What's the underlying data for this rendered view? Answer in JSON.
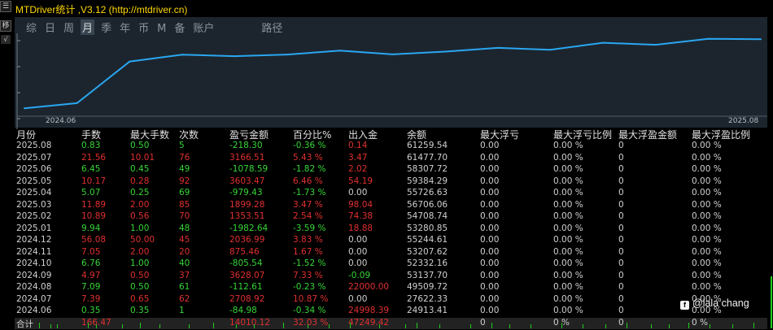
{
  "window": {
    "title": "MTDriver统计 ,V3.12 (http://mtdriver.cn)"
  },
  "left_strip": {
    "top_button": "☰",
    "move_button": "移",
    "check_mark": "√"
  },
  "tabs": [
    {
      "label": "综",
      "active": false
    },
    {
      "label": "日",
      "active": false
    },
    {
      "label": "周",
      "active": false
    },
    {
      "label": "月",
      "active": true
    },
    {
      "label": "季",
      "active": false
    },
    {
      "label": "年",
      "active": false
    },
    {
      "label": "币",
      "active": false
    },
    {
      "label": "M",
      "active": false
    },
    {
      "label": "备",
      "active": false
    },
    {
      "label": "账户",
      "active": false
    },
    {
      "label": "路径",
      "active": false
    }
  ],
  "chart_data": {
    "type": "line",
    "x": [
      "2024.06",
      "2024.07",
      "2024.08",
      "2024.09",
      "2024.10",
      "2024.11",
      "2024.12",
      "2025.01",
      "2025.02",
      "2025.03",
      "2025.04",
      "2025.05",
      "2025.06",
      "2025.07",
      "2025.08"
    ],
    "y": [
      24913.41,
      27622.33,
      49509.72,
      53137.7,
      52332.16,
      53207.62,
      55244.61,
      53280.85,
      54708.74,
      56706.06,
      55726.63,
      59384.29,
      58307.72,
      61477.7,
      61259.54
    ],
    "x_tick_labels": [
      "2024.06",
      "2025.08"
    ],
    "ylim": [
      22000,
      63500
    ],
    "line_color": "#2aa6f0"
  },
  "table": {
    "headers": [
      "月份",
      "手数",
      "最大手数",
      "次数",
      "盈亏金额",
      "百分比%",
      "出入金",
      "余额",
      "最大浮亏",
      "最大浮亏比例",
      "最大浮盈金额",
      "最大浮盈比例"
    ],
    "rows": [
      {
        "cells": [
          "2025.08",
          "0.83",
          "0.50",
          "5",
          "-218.30",
          "-0.36 %",
          "0.14",
          "61259.54",
          "0.00",
          "0.00 %",
          "0",
          "0.00 %"
        ],
        "sign": "neg",
        "flow": "pos"
      },
      {
        "cells": [
          "2025.07",
          "21.56",
          "10.01",
          "76",
          "3166.51",
          "5.43 %",
          "3.47",
          "61477.70",
          "0.00",
          "0.00 %",
          "0",
          "0.00 %"
        ],
        "sign": "pos",
        "flow": "pos"
      },
      {
        "cells": [
          "2025.06",
          "6.45",
          "0.45",
          "49",
          "-1078.59",
          "-1.82 %",
          "2.02",
          "58307.72",
          "0.00",
          "0.00 %",
          "0",
          "0.00 %"
        ],
        "sign": "neg",
        "flow": "pos"
      },
      {
        "cells": [
          "2025.05",
          "10.17",
          "0.28",
          "92",
          "3603.47",
          "6.46 %",
          "54.19",
          "59384.29",
          "0.00",
          "0.00 %",
          "0",
          "0.00 %"
        ],
        "sign": "pos",
        "flow": "pos"
      },
      {
        "cells": [
          "2025.04",
          "5.07",
          "0.25",
          "69",
          "-979.43",
          "-1.73 %",
          "0.00",
          "55726.63",
          "0.00",
          "0.00 %",
          "0",
          "0.00 %"
        ],
        "sign": "neg",
        "flow": "neu"
      },
      {
        "cells": [
          "2025.03",
          "11.89",
          "2.00",
          "85",
          "1899.28",
          "3.47 %",
          "98.04",
          "56706.06",
          "0.00",
          "0.00 %",
          "0",
          "0.00 %"
        ],
        "sign": "pos",
        "flow": "pos"
      },
      {
        "cells": [
          "2025.02",
          "10.89",
          "0.56",
          "70",
          "1353.51",
          "2.54 %",
          "74.38",
          "54708.74",
          "0.00",
          "0.00 %",
          "0",
          "0.00 %"
        ],
        "sign": "pos",
        "flow": "pos"
      },
      {
        "cells": [
          "2025.01",
          "9.94",
          "1.00",
          "48",
          "-1982.64",
          "-3.59 %",
          "18.88",
          "53280.85",
          "0.00",
          "0.00 %",
          "0",
          "0.00 %"
        ],
        "sign": "neg",
        "flow": "pos"
      },
      {
        "cells": [
          "2024.12",
          "56.08",
          "50.00",
          "45",
          "2036.99",
          "3.83 %",
          "0.00",
          "55244.61",
          "0.00",
          "0.00 %",
          "0",
          "0.00 %"
        ],
        "sign": "pos",
        "flow": "neu"
      },
      {
        "cells": [
          "2024.11",
          "7.05",
          "2.00",
          "20",
          "875.46",
          "1.67 %",
          "0.00",
          "53207.62",
          "0.00",
          "0.00 %",
          "0",
          "0.00 %"
        ],
        "sign": "pos",
        "flow": "neu"
      },
      {
        "cells": [
          "2024.10",
          "6.76",
          "1.00",
          "40",
          "-805.54",
          "-1.52 %",
          "0.00",
          "52332.16",
          "0.00",
          "0.00 %",
          "0",
          "0.00 %"
        ],
        "sign": "neg",
        "flow": "neu"
      },
      {
        "cells": [
          "2024.09",
          "4.97",
          "0.50",
          "37",
          "3628.07",
          "7.33 %",
          "-0.09",
          "53137.70",
          "0.00",
          "0.00 %",
          "0",
          "0.00 %"
        ],
        "sign": "pos",
        "flow": "neg"
      },
      {
        "cells": [
          "2024.08",
          "7.09",
          "0.50",
          "61",
          "-112.61",
          "-0.23 %",
          "22000.00",
          "49509.72",
          "0.00",
          "0.00 %",
          "0",
          "0.00 %"
        ],
        "sign": "neg",
        "flow": "pos"
      },
      {
        "cells": [
          "2024.07",
          "7.39",
          "0.65",
          "62",
          "2708.92",
          "10.87 %",
          "0.00",
          "27622.33",
          "0.00",
          "0.00 %",
          "0",
          "0.00 %"
        ],
        "sign": "pos",
        "flow": "neu"
      },
      {
        "cells": [
          "2024.06",
          "0.35",
          "0.35",
          "1",
          "-84.98",
          "-0.34 %",
          "24998.39",
          "24913.41",
          "0.00",
          "0.00 %",
          "0",
          "0.00 %"
        ],
        "sign": "neg",
        "flow": "pos"
      }
    ],
    "total": {
      "label": "合计",
      "lots": "166.47",
      "pnl": "14010.12",
      "pct": "32.03 %",
      "flow": "47249.42",
      "max_loss": "0",
      "max_loss_pct": "0 %",
      "max_gain": "0",
      "max_gain_pct": "0 %"
    }
  },
  "watermark": {
    "icon": "f",
    "text": "@lala chang"
  },
  "colors": {
    "profit": "#e03030",
    "loss": "#36d636",
    "title": "#ffd800",
    "panel": "#1c252e",
    "line": "#2aa6f0"
  }
}
